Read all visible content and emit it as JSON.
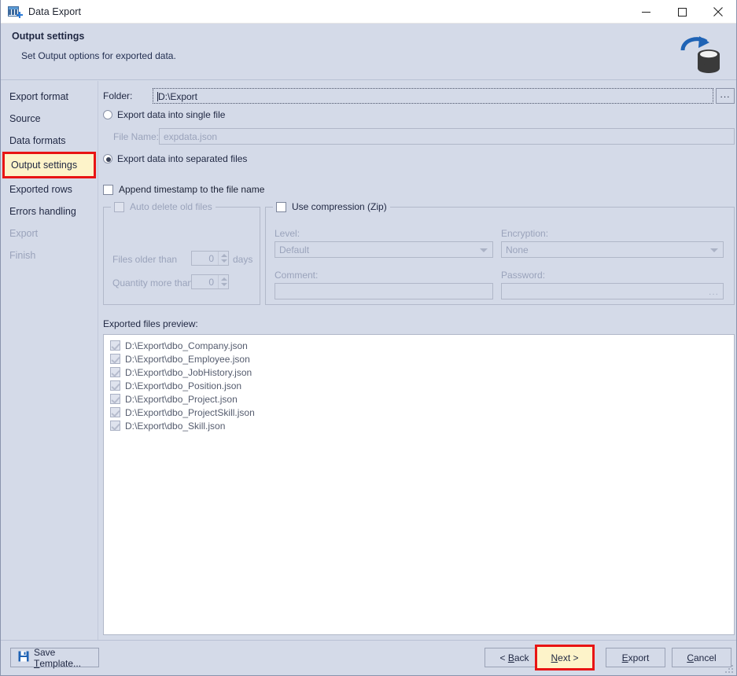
{
  "window": {
    "title": "Data Export",
    "icon": "table-export-icon",
    "controls": {
      "minimize": "minimize-icon",
      "maximize": "maximize-icon",
      "close": "close-icon"
    }
  },
  "header": {
    "title": "Output settings",
    "subtitle": "Set Output options for exported data.",
    "icon": "database-refresh-icon",
    "accent_color": "#2d6fb8"
  },
  "sidebar": {
    "items": [
      {
        "label": "Export format",
        "state": "normal"
      },
      {
        "label": "Source",
        "state": "normal"
      },
      {
        "label": "Data formats",
        "state": "normal"
      },
      {
        "label": "Output settings",
        "state": "active"
      },
      {
        "label": "Exported rows",
        "state": "normal"
      },
      {
        "label": "Errors handling",
        "state": "normal"
      },
      {
        "label": "Export",
        "state": "disabled"
      },
      {
        "label": "Finish",
        "state": "disabled"
      }
    ],
    "highlight_color": "#e81414",
    "highlight_fill": "#fdf3c9"
  },
  "form": {
    "folder": {
      "label": "Folder:",
      "value": "D:\\Export",
      "browse_label": "..."
    },
    "single_file": {
      "label": "Export data into single file",
      "checked": false
    },
    "file_name": {
      "label": "File Name:",
      "value": "expdata.json",
      "enabled": false
    },
    "separated_files": {
      "label": "Export data into separated files",
      "checked": true
    },
    "append_timestamp": {
      "label": "Append timestamp to the file name",
      "checked": false
    },
    "auto_delete": {
      "title": "Auto delete old files",
      "checked": false,
      "files_older_than": {
        "label": "Files older than",
        "value": "0",
        "unit": "days"
      },
      "quantity_more_than": {
        "label": "Quantity more than",
        "value": "0"
      }
    },
    "compression": {
      "title": "Use compression (Zip)",
      "checked": false,
      "level": {
        "label": "Level:",
        "value": "Default"
      },
      "encryption": {
        "label": "Encryption:",
        "value": "None"
      },
      "comment": {
        "label": "Comment:",
        "value": ""
      },
      "password": {
        "label": "Password:",
        "value": "",
        "browse_label": "..."
      }
    },
    "preview": {
      "label": "Exported files preview:",
      "files": [
        {
          "path": "D:\\Export\\dbo_Company.json",
          "checked": true
        },
        {
          "path": "D:\\Export\\dbo_Employee.json",
          "checked": true
        },
        {
          "path": "D:\\Export\\dbo_JobHistory.json",
          "checked": true
        },
        {
          "path": "D:\\Export\\dbo_Position.json",
          "checked": true
        },
        {
          "path": "D:\\Export\\dbo_Project.json",
          "checked": true
        },
        {
          "path": "D:\\Export\\dbo_ProjectSkill.json",
          "checked": true
        },
        {
          "path": "D:\\Export\\dbo_Skill.json",
          "checked": true
        }
      ]
    }
  },
  "footer": {
    "save_template": {
      "label": "Save Template...",
      "icon": "floppy-disk-icon",
      "accel": "T"
    },
    "back": {
      "label": "< Back",
      "accel": "B"
    },
    "next": {
      "label": "Next >",
      "accel": "N",
      "highlighted": true
    },
    "export": {
      "label": "Export",
      "accel": "E"
    },
    "cancel": {
      "label": "Cancel",
      "accel": "C"
    }
  }
}
